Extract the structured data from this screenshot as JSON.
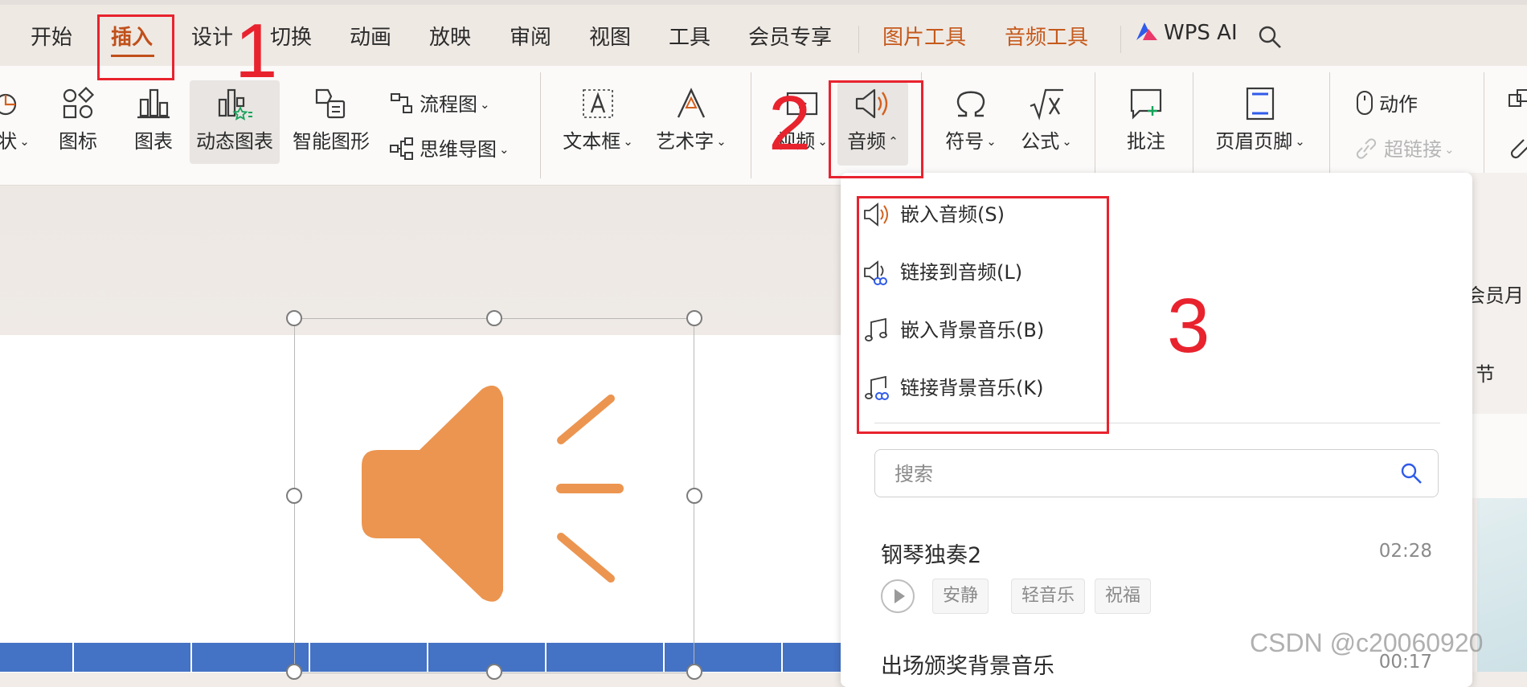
{
  "menubar": {
    "tabs": [
      {
        "label": "开始"
      },
      {
        "label": "插入"
      },
      {
        "label": "设计"
      },
      {
        "label": "切换"
      },
      {
        "label": "动画"
      },
      {
        "label": "放映"
      },
      {
        "label": "审阅"
      },
      {
        "label": "视图"
      },
      {
        "label": "工具"
      },
      {
        "label": "会员专享"
      }
    ],
    "context_tabs": [
      {
        "label": "图片工具"
      },
      {
        "label": "音频工具"
      }
    ],
    "wps_ai": "WPS AI",
    "active_tab": "插入"
  },
  "ribbon": {
    "shape_partial": "状",
    "icon_btn": "图标",
    "chart_btn": "图表",
    "dynamic_chart_btn": "动态图表",
    "smart_shape_btn": "智能图形",
    "flowchart": "流程图",
    "mindmap": "思维导图",
    "textbox": "文本框",
    "wordart": "艺术字",
    "video": "视频",
    "audio": "音频",
    "symbol": "符号",
    "formula": "公式",
    "comment": "批注",
    "header_footer": "页眉页脚",
    "action": "动作",
    "hyperlink": "超链接"
  },
  "audio_menu": {
    "items": [
      {
        "label": "嵌入音频(S)"
      },
      {
        "label": "链接到音频(L)"
      },
      {
        "label": "嵌入背景音乐(B)"
      },
      {
        "label": "链接背景音乐(K)"
      }
    ],
    "search_placeholder": "搜索",
    "tracks": [
      {
        "title": "钢琴独奏2",
        "duration": "02:28",
        "tags": [
          "安静",
          "轻音乐",
          "祝福"
        ]
      },
      {
        "title": "出场颁奖背景音乐",
        "duration": "00:17"
      }
    ]
  },
  "right_sliver": {
    "text1": "会员月",
    "text2": "节"
  },
  "annotations": {
    "n1": "1",
    "n2": "2",
    "n3": "3"
  },
  "watermark": "CSDN @c20060920",
  "colors": {
    "accent": "#c0501a",
    "context": "#c55a1c",
    "annotation": "#e8232e",
    "audio_icon": "#ec9550",
    "slide_bar": "#4472c4"
  }
}
